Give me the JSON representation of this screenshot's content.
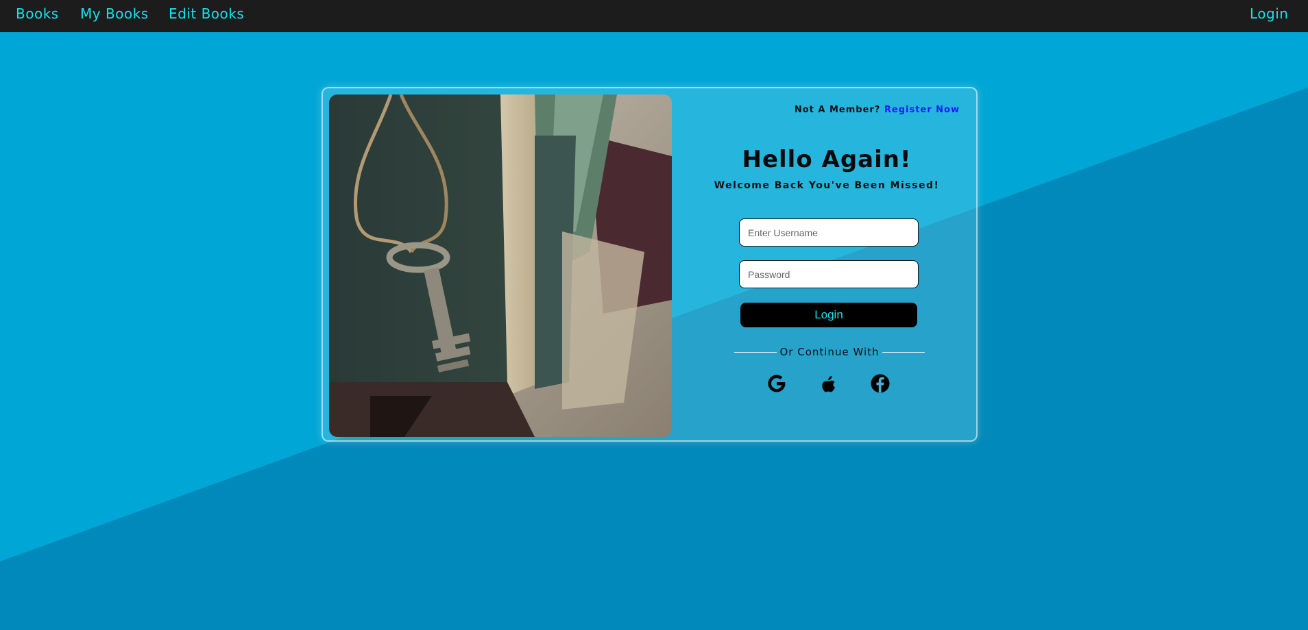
{
  "nav": {
    "books": "Books",
    "my_books": "My Books",
    "edit_books": "Edit Books",
    "login": "Login"
  },
  "login_card": {
    "not_member": "Not A Member?",
    "register": "Register Now",
    "title": "Hello Again!",
    "subtitle": "Welcome Back You've Been Missed!",
    "username_placeholder": "Enter Username",
    "password_placeholder": "Password",
    "login_button": "Login",
    "divider": "Or Continue With",
    "social": [
      "google-icon",
      "apple-icon",
      "facebook-icon"
    ]
  },
  "colors": {
    "nav_bg": "#1c1c1c",
    "nav_link": "#17e3e8",
    "page_bg": "#00a6d6",
    "button_bg": "#000000",
    "register_link": "#1a1aff"
  }
}
